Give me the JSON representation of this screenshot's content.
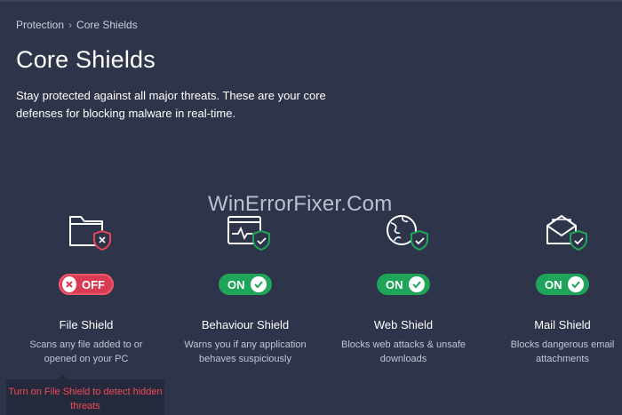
{
  "breadcrumb": {
    "parent": "Protection",
    "separator": "›",
    "current": "Core Shields"
  },
  "page": {
    "title": "Core Shields",
    "description": "Stay protected against all major threats. These are your core defenses for blocking malware in real-time."
  },
  "watermark": "WinErrorFixer.Com",
  "shields": [
    {
      "name": "File Shield",
      "status": "OFF",
      "description": "Scans any file added to or opened on your PC",
      "icon": "folder-icon"
    },
    {
      "name": "Behaviour Shield",
      "status": "ON",
      "description": "Warns you if any application behaves suspiciously",
      "icon": "monitor-pulse-icon"
    },
    {
      "name": "Web Shield",
      "status": "ON",
      "description": "Blocks web attacks & unsafe downloads",
      "icon": "globe-icon"
    },
    {
      "name": "Mail Shield",
      "status": "ON",
      "description": "Blocks dangerous email attachments",
      "icon": "envelope-icon"
    }
  ],
  "tooltip": {
    "text": "Turn on File Shield to detect hidden threats"
  },
  "colors": {
    "background": "#2e3449",
    "on": "#1fa55a",
    "off": "#d83b52",
    "warning_text": "#ef4a57"
  }
}
